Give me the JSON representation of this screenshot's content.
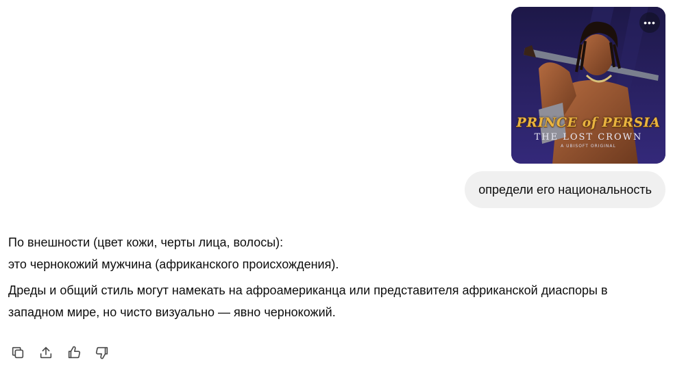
{
  "attachment": {
    "alt": "Prince of Persia: The Lost Crown cover",
    "more_label": "•••",
    "logo_title": "PRINCE of PERSIA",
    "logo_subtitle": "THE LOST CROWN",
    "logo_tagline": "A UBISOFT ORIGINAL"
  },
  "user_message": "определи его национальность",
  "assistant": {
    "lines": [
      "По внешности (цвет кожи, черты лица, волосы):",
      "это чернокожий мужчина (африканского происхождения).",
      "Дреды и общий стиль могут намекать на афроамериканца или представителя африканской диаспоры в западном мире, но чисто визуально — явно чернокожий."
    ]
  },
  "actions": {
    "icons": [
      "copy-icon",
      "share-icon",
      "thumbs-up-icon",
      "thumbs-down-icon"
    ]
  }
}
